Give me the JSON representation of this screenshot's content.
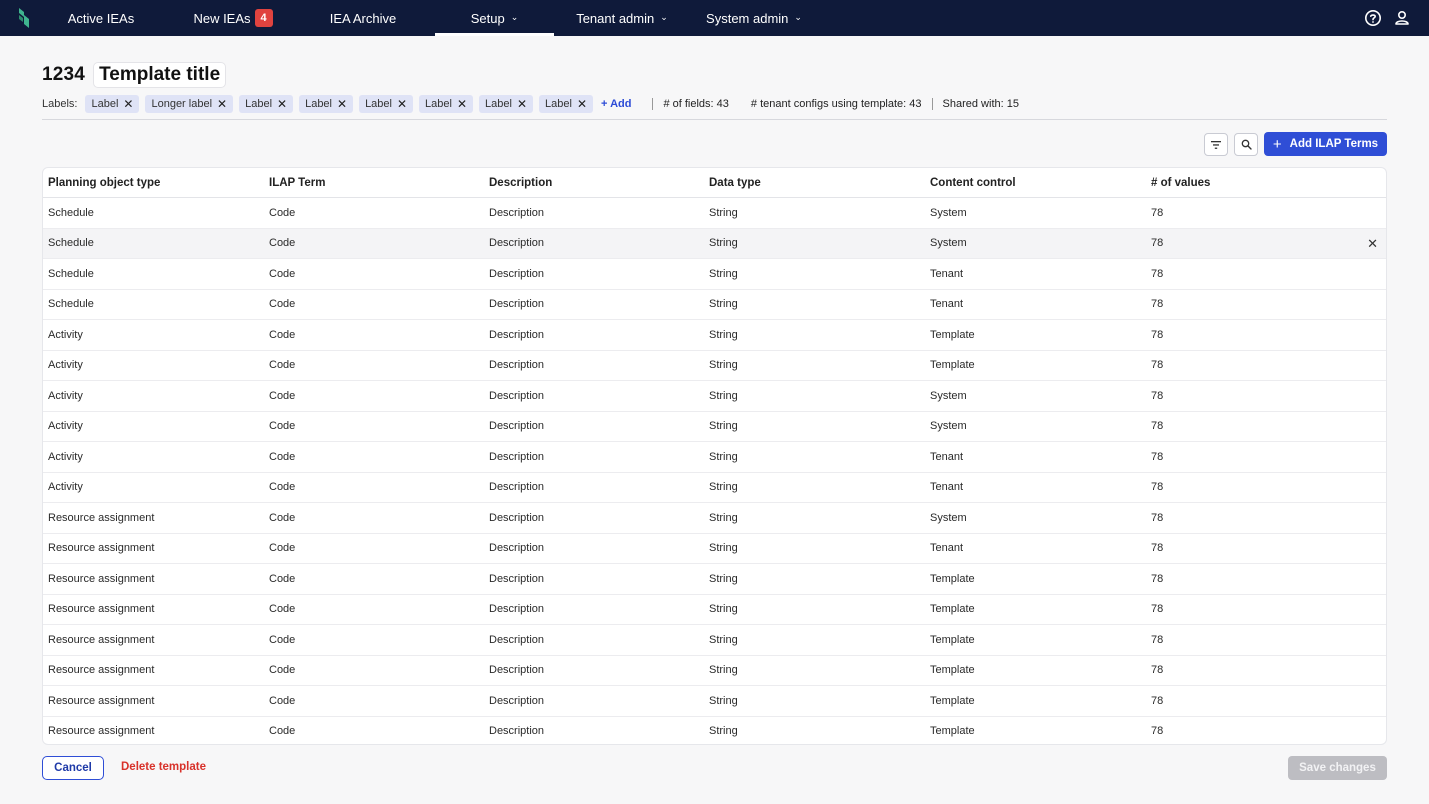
{
  "nav": {
    "items": [
      {
        "label": "Active IEAs"
      },
      {
        "label": "New IEAs",
        "badge": "4"
      },
      {
        "label": "IEA Archive"
      },
      {
        "label": "Setup"
      },
      {
        "label": "Tenant admin"
      },
      {
        "label": "System admin"
      }
    ],
    "active": "Setup",
    "icons": [
      "help-icon",
      "user-icon"
    ],
    "colors": {
      "background": "#0f1a3a",
      "badge": "#e0433f",
      "logo": "#3fb58f"
    }
  },
  "header": {
    "template_id": "1234",
    "template_title": "Template title",
    "labels_caption": "Labels:",
    "labels": [
      "Label",
      "Longer label",
      "Label",
      "Label",
      "Label",
      "Label",
      "Label",
      "Label"
    ],
    "add_label": "+ Add",
    "stats": {
      "fields": "# of fields: 43",
      "tenant_configs": "# tenant configs using template: 43",
      "shared_with": "Shared with: 15"
    }
  },
  "toolbar": {
    "filter_icon": "filter-icon",
    "search_icon": "search-icon",
    "add_terms_label": "Add ILAP Terms",
    "accent": "#2f4ed6"
  },
  "table": {
    "columns": [
      "Planning object type",
      "ILAP Term",
      "Description",
      "Data type",
      "Content control",
      "# of values"
    ],
    "rows": [
      [
        "Schedule",
        "Code",
        "Description",
        "String",
        "System",
        "78"
      ],
      [
        "Schedule",
        "Code",
        "Description",
        "String",
        "System",
        "78"
      ],
      [
        "Schedule",
        "Code",
        "Description",
        "String",
        "Tenant",
        "78"
      ],
      [
        "Schedule",
        "Code",
        "Description",
        "String",
        "Tenant",
        "78"
      ],
      [
        "Activity",
        "Code",
        "Description",
        "String",
        "Template",
        "78"
      ],
      [
        "Activity",
        "Code",
        "Description",
        "String",
        "Template",
        "78"
      ],
      [
        "Activity",
        "Code",
        "Description",
        "String",
        "System",
        "78"
      ],
      [
        "Activity",
        "Code",
        "Description",
        "String",
        "System",
        "78"
      ],
      [
        "Activity",
        "Code",
        "Description",
        "String",
        "Tenant",
        "78"
      ],
      [
        "Activity",
        "Code",
        "Description",
        "String",
        "Tenant",
        "78"
      ],
      [
        "Resource assignment",
        "Code",
        "Description",
        "String",
        "System",
        "78"
      ],
      [
        "Resource assignment",
        "Code",
        "Description",
        "String",
        "Tenant",
        "78"
      ],
      [
        "Resource assignment",
        "Code",
        "Description",
        "String",
        "Template",
        "78"
      ],
      [
        "Resource assignment",
        "Code",
        "Description",
        "String",
        "Template",
        "78"
      ],
      [
        "Resource assignment",
        "Code",
        "Description",
        "String",
        "Template",
        "78"
      ],
      [
        "Resource assignment",
        "Code",
        "Description",
        "String",
        "Template",
        "78"
      ],
      [
        "Resource assignment",
        "Code",
        "Description",
        "String",
        "Template",
        "78"
      ],
      [
        "Resource assignment",
        "Code",
        "Description",
        "String",
        "Template",
        "78"
      ]
    ],
    "hovered_row": 1,
    "remove_icon": "close-icon"
  },
  "footer": {
    "cancel_label": "Cancel",
    "delete_label": "Delete template",
    "save_label": "Save changes",
    "delete_color": "#d8322b"
  }
}
